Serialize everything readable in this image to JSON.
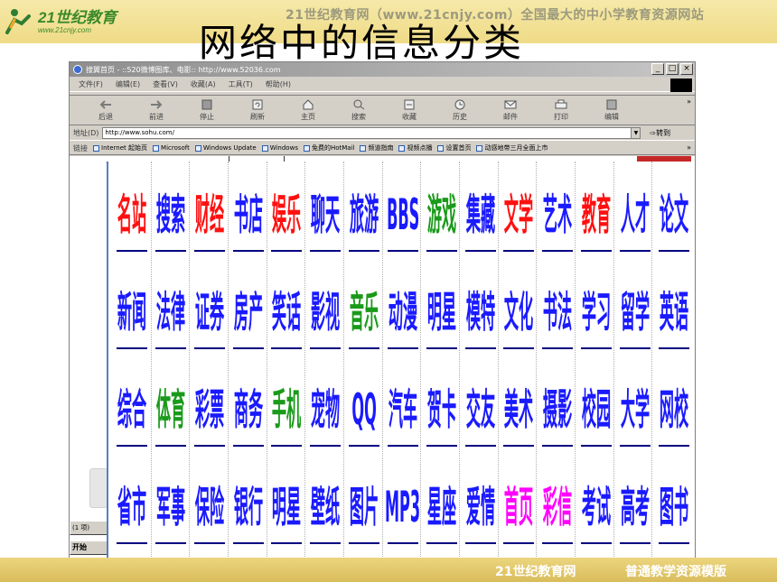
{
  "slide": {
    "brand_name": "21世纪教育",
    "brand_url": "www.21cnjy.com",
    "slogan": "21世纪教育网（www.21cnjy.com）全国最大的中小学教育资源网站",
    "title": "网络中的信息分类",
    "footer_left": "21世纪教育网",
    "footer_right": "普通教学资源模版"
  },
  "browser": {
    "window_title": "搜翼首页 - ::520微博图库、电影:: http://www.52036.com",
    "menu": [
      "文件(F)",
      "编辑(E)",
      "查看(V)",
      "收藏(A)",
      "工具(T)",
      "帮助(H)"
    ],
    "toolbar": [
      "后退",
      "前进",
      "停止",
      "刷新",
      "主页",
      "搜索",
      "收藏",
      "历史",
      "邮件",
      "打印",
      "编辑"
    ],
    "address_label": "地址(D)",
    "address_value": "http://www.sohu.com/",
    "go_label": "转到",
    "links_label": "链接",
    "links": [
      "Internet 起始页",
      "Microsoft",
      "Windows Update",
      "Windows",
      "免费的HotMail",
      "频道指南",
      "视频点播",
      "设置首页",
      "动感地带三月全面上市"
    ],
    "taskbar_item": "(1 项)",
    "start_label": "开始"
  },
  "colors": {
    "red": "#ff1010",
    "blue": "#1a1aff",
    "green": "#1a9a1a",
    "magenta": "#ff00ff",
    "underline": "#000080"
  },
  "categories": [
    [
      {
        "label": "名站",
        "color": "red"
      },
      {
        "label": "搜索",
        "color": "blue"
      },
      {
        "label": "财经",
        "color": "red"
      },
      {
        "label": "书店",
        "color": "blue"
      },
      {
        "label": "娱乐",
        "color": "red"
      },
      {
        "label": "聊天",
        "color": "blue"
      },
      {
        "label": "旅游",
        "color": "blue"
      },
      {
        "label": "BBS",
        "color": "blue"
      },
      {
        "label": "游戏",
        "color": "green"
      },
      {
        "label": "集藏",
        "color": "blue"
      },
      {
        "label": "文学",
        "color": "red"
      },
      {
        "label": "艺术",
        "color": "blue"
      },
      {
        "label": "教育",
        "color": "red"
      },
      {
        "label": "人才",
        "color": "blue"
      },
      {
        "label": "论文",
        "color": "blue"
      }
    ],
    [
      {
        "label": "新闻",
        "color": "blue"
      },
      {
        "label": "法律",
        "color": "blue"
      },
      {
        "label": "证券",
        "color": "blue"
      },
      {
        "label": "房产",
        "color": "blue"
      },
      {
        "label": "笑话",
        "color": "blue"
      },
      {
        "label": "影视",
        "color": "blue"
      },
      {
        "label": "音乐",
        "color": "green"
      },
      {
        "label": "动漫",
        "color": "blue"
      },
      {
        "label": "明星",
        "color": "blue"
      },
      {
        "label": "模特",
        "color": "blue"
      },
      {
        "label": "文化",
        "color": "blue"
      },
      {
        "label": "书法",
        "color": "blue"
      },
      {
        "label": "学习",
        "color": "blue"
      },
      {
        "label": "留学",
        "color": "blue"
      },
      {
        "label": "英语",
        "color": "blue"
      }
    ],
    [
      {
        "label": "综合",
        "color": "blue"
      },
      {
        "label": "体育",
        "color": "green"
      },
      {
        "label": "彩票",
        "color": "blue"
      },
      {
        "label": "商务",
        "color": "blue"
      },
      {
        "label": "手机",
        "color": "green"
      },
      {
        "label": "宠物",
        "color": "blue"
      },
      {
        "label": "QQ",
        "color": "blue"
      },
      {
        "label": "汽车",
        "color": "blue"
      },
      {
        "label": "贺卡",
        "color": "blue"
      },
      {
        "label": "交友",
        "color": "blue"
      },
      {
        "label": "美术",
        "color": "blue"
      },
      {
        "label": "摄影",
        "color": "blue"
      },
      {
        "label": "校园",
        "color": "blue"
      },
      {
        "label": "大学",
        "color": "blue"
      },
      {
        "label": "网校",
        "color": "blue"
      }
    ],
    [
      {
        "label": "省市",
        "color": "blue"
      },
      {
        "label": "军事",
        "color": "blue"
      },
      {
        "label": "保险",
        "color": "blue"
      },
      {
        "label": "银行",
        "color": "blue"
      },
      {
        "label": "明星",
        "color": "blue"
      },
      {
        "label": "壁纸",
        "color": "blue"
      },
      {
        "label": "图片",
        "color": "blue"
      },
      {
        "label": "MP3",
        "color": "blue"
      },
      {
        "label": "星座",
        "color": "blue"
      },
      {
        "label": "爱情",
        "color": "blue"
      },
      {
        "label": "首页",
        "color": "magenta"
      },
      {
        "label": "彩信",
        "color": "magenta"
      },
      {
        "label": "考试",
        "color": "blue"
      },
      {
        "label": "高考",
        "color": "blue"
      },
      {
        "label": "图书",
        "color": "blue"
      }
    ]
  ]
}
